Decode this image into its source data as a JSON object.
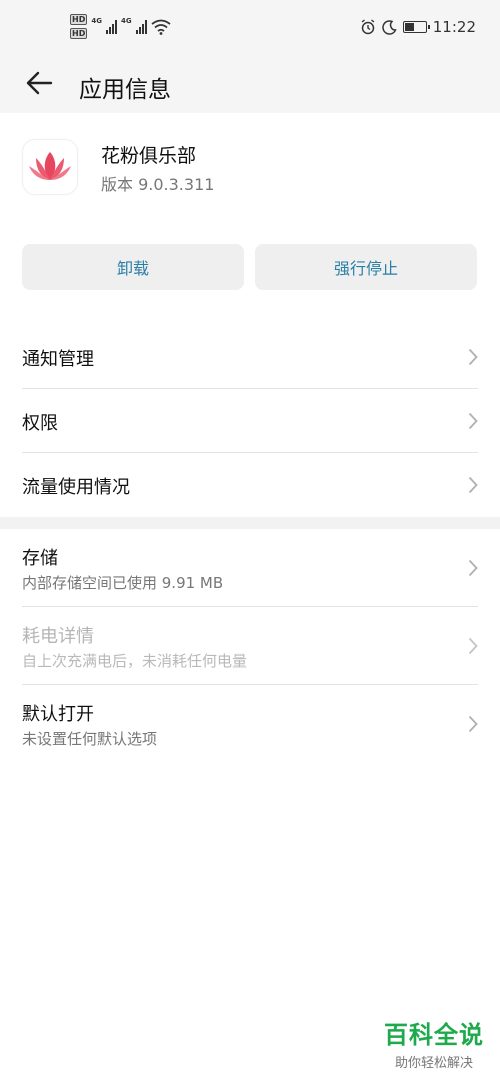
{
  "status_bar": {
    "hd_badge": "HD",
    "network": "4G",
    "time": "11:22",
    "battery_level": 0.45
  },
  "header": {
    "title": "应用信息"
  },
  "app": {
    "name": "花粉俱乐部",
    "version": "版本 9.0.3.311",
    "icon": "lotus-icon"
  },
  "actions": {
    "uninstall": "卸载",
    "force_stop": "强行停止"
  },
  "list_a": [
    {
      "label": "通知管理"
    },
    {
      "label": "权限"
    },
    {
      "label": "流量使用情况"
    }
  ],
  "list_b": [
    {
      "label": "存储",
      "sub": "内部存储空间已使用 9.91 MB"
    },
    {
      "label": "耗电详情",
      "sub": "自上次充满电后，未消耗任何电量"
    },
    {
      "label": "默认打开",
      "sub": "未设置任何默认选项"
    }
  ],
  "watermark": {
    "title": "百科全说",
    "subtitle": "助你轻松解决"
  },
  "colors": {
    "accent": "#2a7fa5",
    "lotus": "#e8455f",
    "watermark": "#1fa94d"
  }
}
